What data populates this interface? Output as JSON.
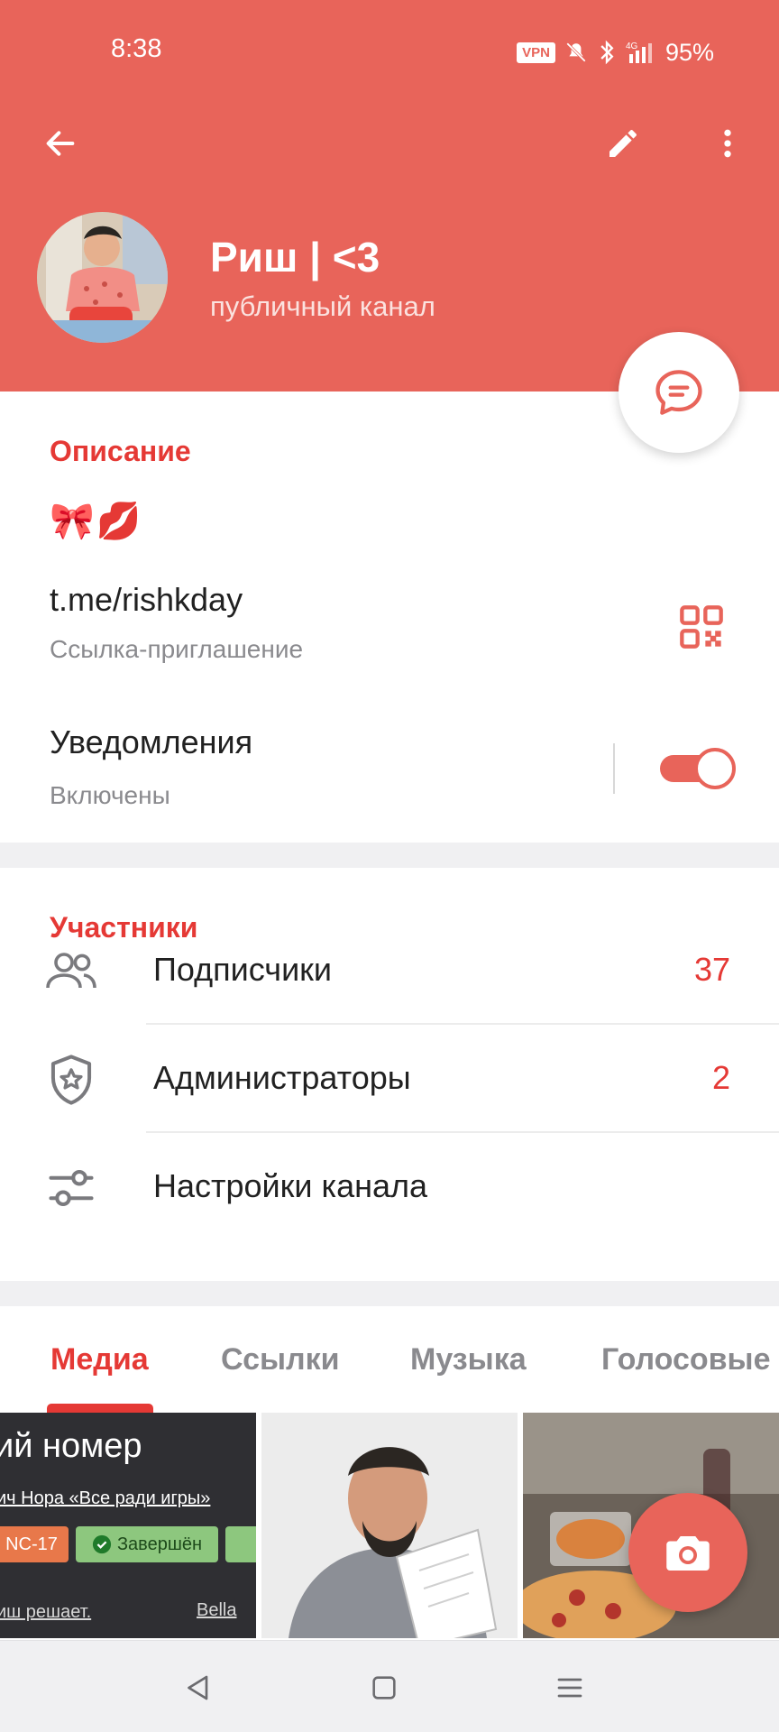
{
  "status_bar": {
    "time": "8:38",
    "vpn": "VPN",
    "battery": "95%"
  },
  "header": {
    "title": "Риш | <3",
    "subtitle": "публичный канал",
    "color": "#e8645a"
  },
  "description": {
    "section_title": "Описание",
    "text": "🎀💋"
  },
  "link": {
    "url": "t.me/rishkday",
    "caption": "Ссылка-приглашение"
  },
  "notifications": {
    "label": "Уведомления",
    "state": "Включены",
    "enabled": true
  },
  "members": {
    "section_title": "Участники",
    "rows": [
      {
        "label": "Подписчики",
        "count": "37",
        "icon": "users-icon"
      },
      {
        "label": "Администраторы",
        "count": "2",
        "icon": "shield-star-icon"
      },
      {
        "label": "Настройки канала",
        "count": "",
        "icon": "sliders-icon"
      }
    ]
  },
  "tabs": [
    {
      "label": "Медиа",
      "active": true
    },
    {
      "label": "Ссылки",
      "active": false
    },
    {
      "label": "Музыка",
      "active": false
    },
    {
      "label": "Голосовые",
      "active": false
    }
  ],
  "media": {
    "item1": {
      "heading": "ий номер",
      "line": "ич Нора «Все ради игры»",
      "badge_rating": "NC-17",
      "badge_status": "Завершён",
      "line2": "иш решает.",
      "author": "Bella"
    }
  },
  "accent_color": "#e53935"
}
